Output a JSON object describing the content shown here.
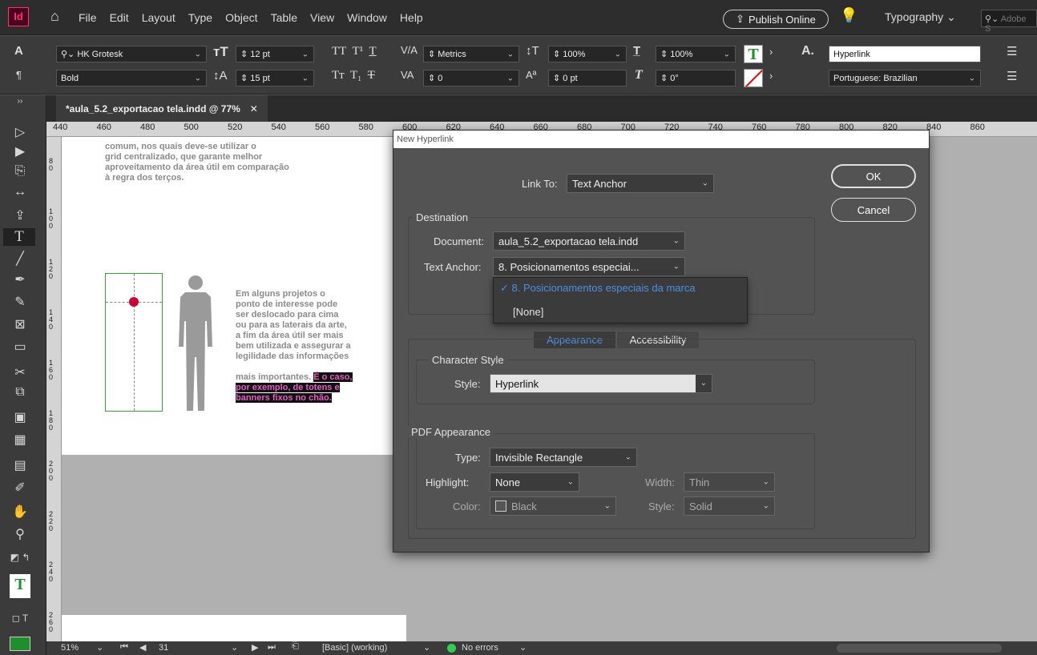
{
  "app": {
    "logo": "Id"
  },
  "menubar": {
    "items": [
      "File",
      "Edit",
      "Layout",
      "Type",
      "Object",
      "Table",
      "View",
      "Window",
      "Help"
    ],
    "publish": "Publish Online",
    "workspace": "Typography",
    "search_placeholder": "Adobe S"
  },
  "control": {
    "font_family": "HK Grotesk",
    "font_style": "Bold",
    "font_size": "12 pt",
    "leading": "15 pt",
    "kerning": "Metrics",
    "tracking": "0",
    "vscale": "100%",
    "hscale": "100%",
    "baseline": "0 pt",
    "skew": "0°",
    "char_style": "Hyperlink",
    "language": "Portuguese: Brazilian"
  },
  "document": {
    "tab_title": "*aula_5.2_exportacao tela.indd @ 77%",
    "ruler_top": [
      "440",
      "460",
      "480",
      "500",
      "520",
      "540",
      "560",
      "580",
      "600",
      "620",
      "640",
      "660",
      "680",
      "700",
      "720",
      "740",
      "760",
      "780",
      "800",
      "820",
      "840",
      "860"
    ],
    "ruler_left": [
      "80",
      "100",
      "120",
      "140",
      "160",
      "180",
      "200",
      "220",
      "240",
      "260"
    ],
    "text_top": [
      "comum, nos quais deve-se utilizar o",
      "grid centralizado, que garante melhor",
      "aproveitamento da área útil em comparação",
      "à regra dos terços."
    ],
    "text_mid": [
      "Em alguns projetos o",
      "ponto de interesse pode",
      "ser deslocado para cima",
      "ou para as laterais da arte,",
      "a fim da área útil ser mais",
      "bem utilizada e assegurar a",
      "legilidade das informações"
    ],
    "text_last_plain": "mais importantes. ",
    "text_highlight": [
      "É o caso,",
      "por exemplo, de totens e",
      "banners fixos no chão."
    ]
  },
  "status": {
    "zoom": "51%",
    "page": "31",
    "preflight_profile": "[Basic] (working)",
    "preflight": "No errors"
  },
  "dialog": {
    "title": "New Hyperlink",
    "link_to_label": "Link To:",
    "link_to": "Text Anchor",
    "ok": "OK",
    "cancel": "Cancel",
    "destination": "Destination",
    "document_label": "Document:",
    "document": "aula_5.2_exportacao tela.indd",
    "anchor_label": "Text Anchor:",
    "anchor": "8. Posicionamentos especiai...",
    "anchor_options": [
      "8. Posicionamentos especiais da marca",
      "[None]"
    ],
    "tabs": [
      "Appearance",
      "Accessibility"
    ],
    "char_style_group": "Character Style",
    "style_label": "Style:",
    "style": "Hyperlink",
    "pdf_group": "PDF Appearance",
    "type_label": "Type:",
    "type": "Invisible Rectangle",
    "highlight_label": "Highlight:",
    "highlight": "None",
    "width_label": "Width:",
    "width": "Thin",
    "color_label": "Color:",
    "color": "Black",
    "style2_label": "Style:",
    "style2": "Solid"
  },
  "colors": {
    "accent": "#4a90e2",
    "highlight_text": "#d4148c",
    "logo_bg": "#49021f",
    "logo_fg": "#ff3366",
    "guide": "#cc0033"
  }
}
